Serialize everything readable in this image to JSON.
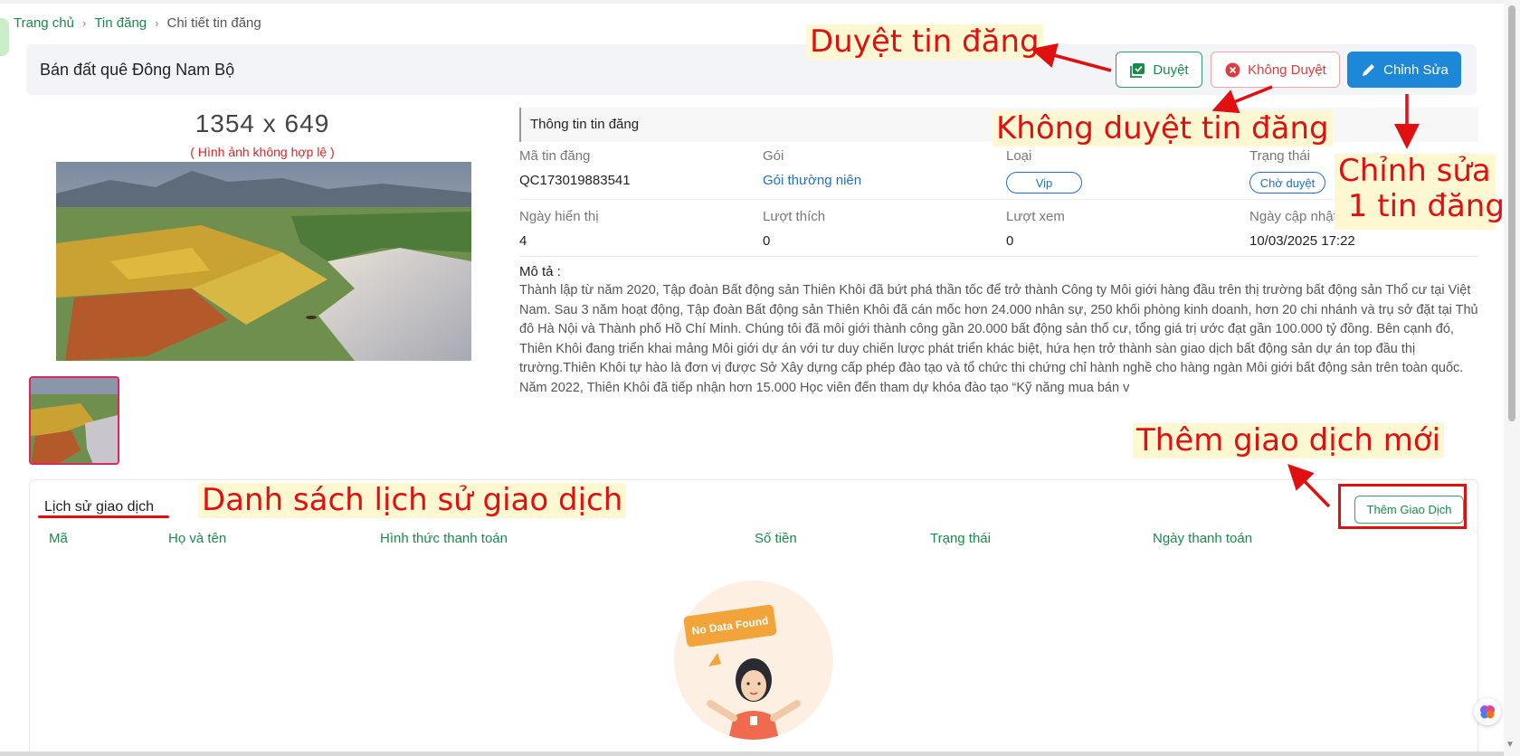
{
  "breadcrumb": {
    "home": "Trang chủ",
    "listings": "Tin đăng",
    "current": "Chi tiết tin đăng"
  },
  "header": {
    "title": "Bán đất quê Đông Nam Bộ",
    "approve_label": "Duyệt",
    "reject_label": "Không Duyệt",
    "edit_label": "Chỉnh Sửa"
  },
  "image": {
    "dimensions": "1354 x 649",
    "invalid_note": "( Hình ảnh không hợp lệ )"
  },
  "info": {
    "section_title": "Thông tin tin đăng",
    "code_label": "Mã tin đăng",
    "code_value": "QC173019883541",
    "package_label": "Gói",
    "package_value": "Gói thường niên",
    "type_label": "Loại",
    "type_value": "Vip",
    "status_label": "Trạng thái",
    "status_value": "Chờ duyệt",
    "display_days_label": "Ngày hiển thị",
    "display_days_value": "4",
    "likes_label": "Lượt thích",
    "likes_value": "0",
    "views_label": "Lượt xem",
    "views_value": "0",
    "updated_label": "Ngày cập nhật",
    "updated_value": "10/03/2025 17:22",
    "description_label": "Mô tả :",
    "description": "Thành lập từ năm 2020, Tập đoàn Bất động sản Thiên Khôi đã bứt phá thần tốc để trở thành Công ty Môi giới hàng đầu trên thị trường bất động sản Thổ cư tại Việt Nam. Sau 3 năm hoạt động, Tập đoàn Bất động sản Thiên Khôi đã cán mốc hơn 24.000 nhân sự, 250 khối phòng kinh doanh, hơn 20 chi nhánh và trụ sở đặt tại Thủ đô Hà Nội và Thành phố Hồ Chí Minh. Chúng tôi đã môi giới thành công gần 20.000 bất động sản thổ cư, tổng giá trị ước đạt gần 100.000 tỷ đồng. Bên cạnh đó, Thiên Khôi đang triển khai mảng Môi giới dự án với tư duy chiến lược phát triển khác biệt, hứa hẹn trở thành sàn giao dịch bất động sản dự án top đầu thị trường.Thiên Khôi tự hào là đơn vị được Sở Xây dựng cấp phép đào tạo và tổ chức thi chứng chỉ hành nghề cho hàng ngàn Môi giới bất động sản trên toàn quốc. Năm 2022, Thiên Khôi đã tiếp nhận hơn 15.000 Học viên đến tham dự khóa đào tạo “Kỹ năng mua bán v"
  },
  "transactions": {
    "title": "Lịch sử giao dịch",
    "add_label": "Thêm Giao Dịch",
    "columns": [
      "Mã",
      "Họ và tên",
      "Hình thức thanh toán",
      "Số tiền",
      "Trạng thái",
      "Ngày thanh toán"
    ],
    "empty_label": "No Data Found"
  },
  "annotations": {
    "approve": "Duyệt tin đăng",
    "reject": "Không duyệt tin đăng",
    "edit_line1": "Chỉnh sửa",
    "edit_line2": " 1 tin đăng",
    "add": "Thêm giao dịch mới",
    "history": "Danh sách lịch sử giao dịch"
  },
  "colors": {
    "green": "#1a8a4a",
    "red": "#e01010",
    "blue": "#1e88d8",
    "annotation_bg": "#fdf8d2"
  },
  "icons": [
    "chevron-right-icon",
    "checklist-icon",
    "close-circle-icon",
    "pencil-icon",
    "brain-icon"
  ]
}
